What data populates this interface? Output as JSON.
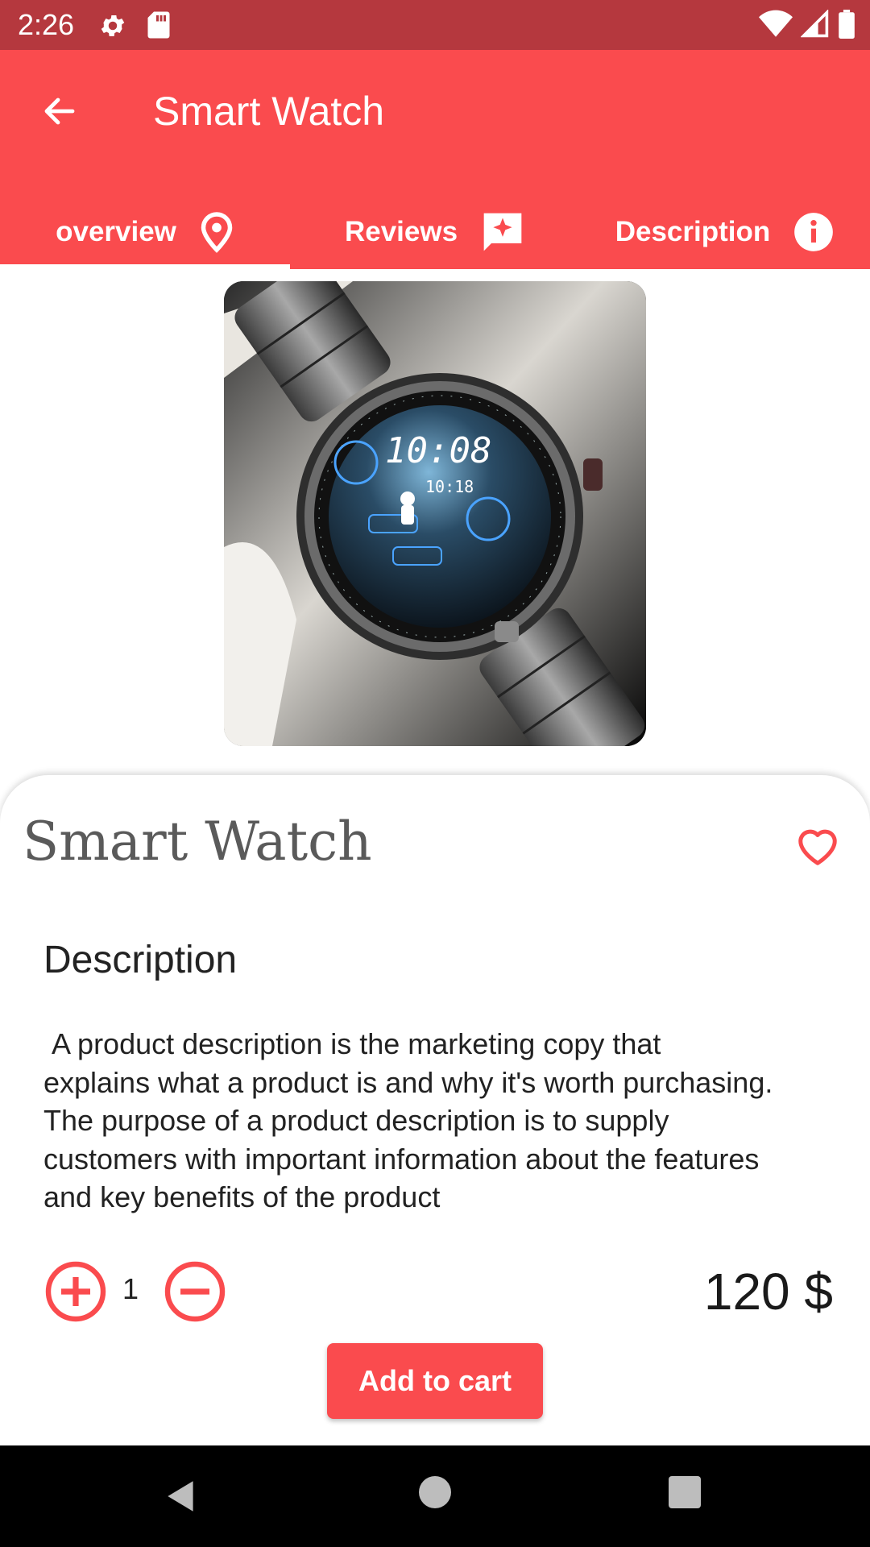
{
  "status_bar": {
    "time": "2:26",
    "icons": [
      "gear-icon",
      "sd-card-icon",
      "wifi-icon",
      "signal-icon",
      "battery-icon"
    ]
  },
  "app_bar": {
    "title": "Smart Watch",
    "back_icon": "arrow-left-icon",
    "color": "#fa4b4e"
  },
  "tabs": [
    {
      "label": "overview",
      "icon": "location-pin-icon",
      "selected": true
    },
    {
      "label": "Reviews",
      "icon": "chat-star-icon",
      "selected": false
    },
    {
      "label": "Description",
      "icon": "info-icon",
      "selected": false
    }
  ],
  "product": {
    "name": "Smart Watch",
    "favorite_icon": "heart-outline-icon",
    "description_heading": "Description",
    "description_text": " A product description is the marketing copy that\nexplains what a product is and why it's worth purchasing.\nThe purpose of a product description is to supply\ncustomers with important information about the features\nand key benefits of the product",
    "quantity": "1",
    "price": "120 $",
    "add_to_cart_label": "Add to cart"
  },
  "colors": {
    "accent": "#fa4b4e",
    "status_bar": "#b5383e"
  }
}
